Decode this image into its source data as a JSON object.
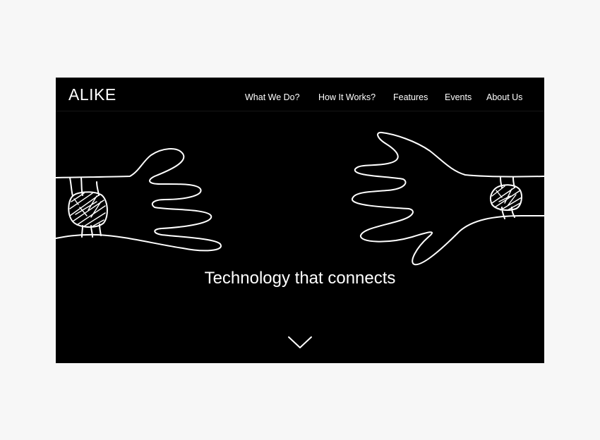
{
  "brand": {
    "logo_text": "ALIKE"
  },
  "nav": {
    "items": [
      {
        "label": "What We Do?"
      },
      {
        "label": "How It Works?"
      },
      {
        "label": "Features"
      },
      {
        "label": "Events"
      },
      {
        "label": "About Us"
      }
    ]
  },
  "hero": {
    "title": "Technology that connects",
    "scroll_icon": "chevron-down-icon",
    "illustration_left": "hand-with-watch-illustration",
    "illustration_right": "hand-with-watch-illustration"
  },
  "colors": {
    "page_background": "#f7f7f7",
    "site_background": "#000000",
    "foreground": "#ffffff"
  }
}
